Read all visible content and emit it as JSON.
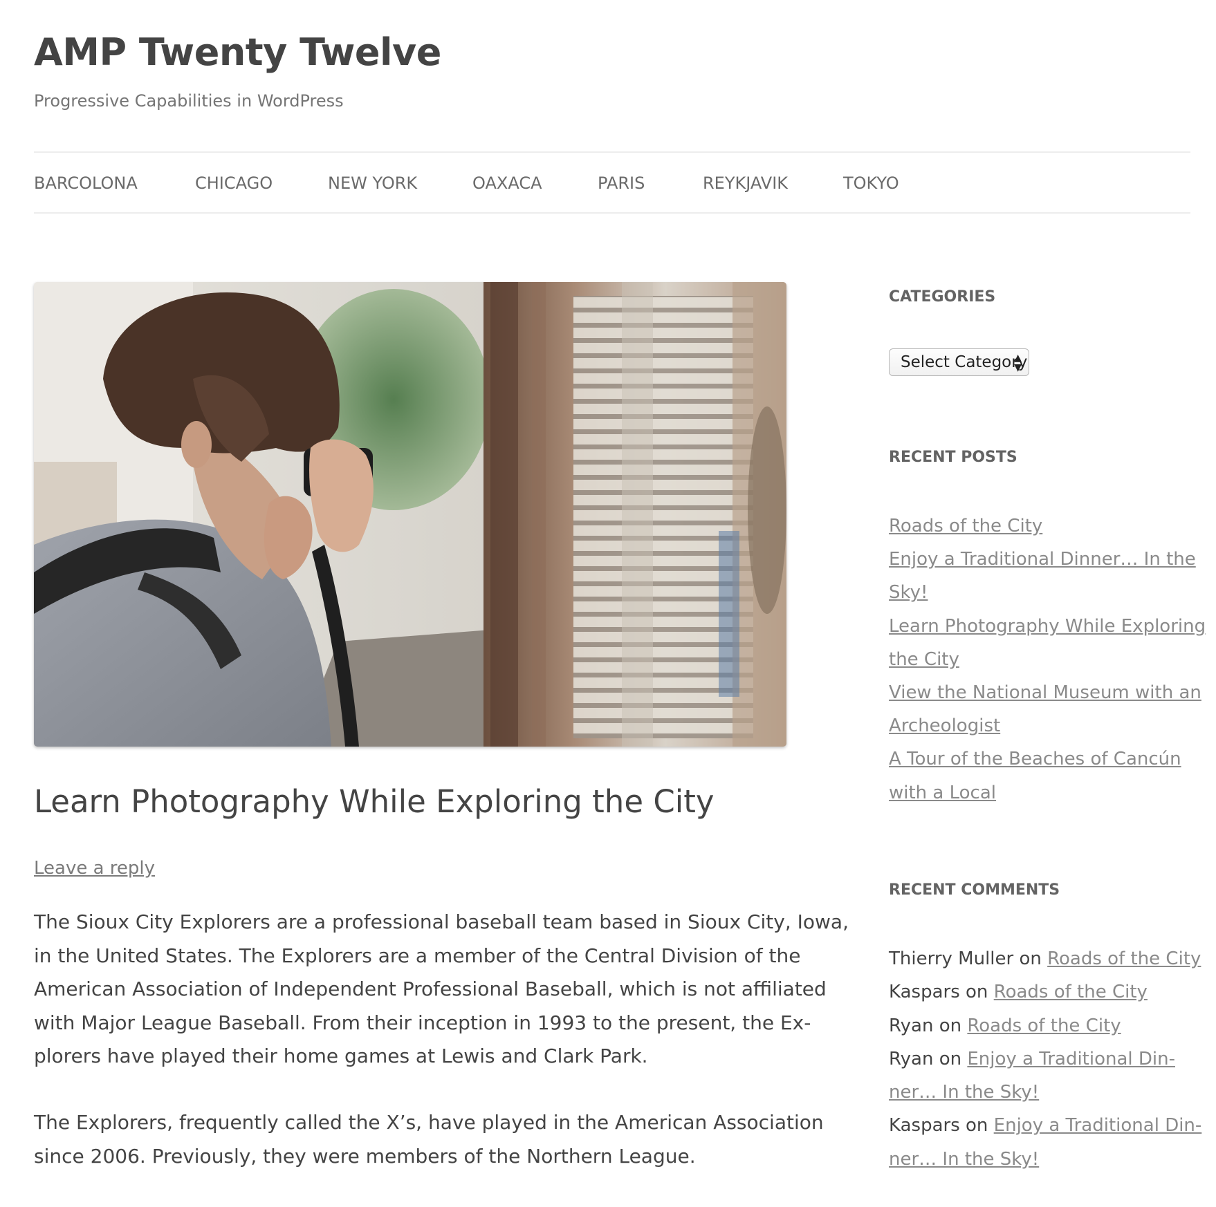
{
  "site": {
    "title": "AMP Twenty Twelve",
    "description": "Progressive Capabilities in WordPress"
  },
  "nav": {
    "items": [
      "BARCOLONA",
      "CHICAGO",
      "NEW YORK",
      "OAXACA",
      "PARIS",
      "REYKJAVIK",
      "TOKYO"
    ]
  },
  "post": {
    "title": "Learn Photography While Exploring the City",
    "reply_link": "Leave a reply",
    "paragraphs": [
      [
        "The Sioux City Explorers are a professional baseball team based in Sioux City, Iowa,",
        "in the United States. The Explorers are a member of the Central Division of the",
        "American Association of Independent Professional Baseball, which is not affiliated",
        "with Major League Baseball. From their inception in 1993 to the present, the Ex-",
        "plorers have played their home games at Lewis and Clark Park."
      ],
      [
        "The Explorers, frequently called the X’s, have played in the American Association",
        "since 2006. Previously, they were members of the Northern League."
      ]
    ]
  },
  "sidebar": {
    "categories": {
      "title": "CATEGORIES",
      "select_value": "Select Category"
    },
    "recent_posts": {
      "title": "RECENT POSTS",
      "items": [
        [
          "Roads of the City"
        ],
        [
          "Enjoy a Traditional Dinner… In the",
          "Sky!"
        ],
        [
          "Learn Photography While Exploring",
          "the City"
        ],
        [
          "View the National Museum with an",
          "Archeologist"
        ],
        [
          "A Tour of the Beaches of Cancún",
          "with a Local"
        ]
      ]
    },
    "recent_comments": {
      "title": "RECENT COMMENTS",
      "items": [
        {
          "author": "Thierry Muller",
          "on": "on",
          "link": [
            "Roads of the City"
          ]
        },
        {
          "author": "Kaspars",
          "on": "on",
          "link": [
            "Roads of the City"
          ]
        },
        {
          "author": "Ryan",
          "on": "on",
          "link": [
            "Roads of the City"
          ]
        },
        {
          "author": "Ryan",
          "on": "on",
          "link": [
            "Enjoy a Traditional Din-",
            "ner… In the Sky!"
          ]
        },
        {
          "author": "Kaspars",
          "on": "on",
          "link": [
            "Enjoy a Traditional Din-",
            "ner… In the Sky!"
          ]
        }
      ]
    }
  },
  "colors": {
    "text": "#444444",
    "muted": "#757575",
    "link": "#8a8a8a",
    "border": "#ededed"
  }
}
